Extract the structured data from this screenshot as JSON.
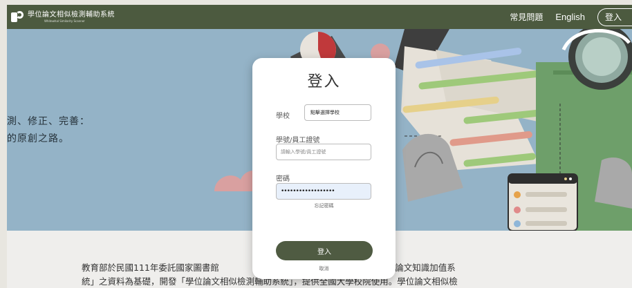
{
  "header": {
    "logo_title": "學位論文相似檢測輔助系統",
    "logo_subtitle": "Whitewhal Similarity Scanner",
    "nav": {
      "faq": "常見問題",
      "language": "English",
      "login": "登入"
    }
  },
  "hero": {
    "line1": "測、修正、完善：",
    "line2": "的原創之路。"
  },
  "intro": {
    "line1": "教育部於民國111年委託國家圖書館                                          以「臺灣博碩士論文知識加值系",
    "line2": "統」之資料為基礎，開發「學位論文相似檢測輔助系統」，提供全國大學校院使用。學位論文相似檢"
  },
  "login_modal": {
    "title": "登入",
    "school_label": "學校",
    "school_button": "點擊選擇學校",
    "id_label": "學號/員工證號",
    "id_placeholder": "請輸入學號/員工證號",
    "password_label": "密碼",
    "password_value": "••••••••••••••••••",
    "forgot_password": "忘記密碼",
    "submit": "登入",
    "cancel": "取消"
  },
  "colors": {
    "topbar": "#4c5a3f",
    "hero_bg": "#94b3c7",
    "accent_green": "#4f5b42",
    "page_bg": "#efeeec"
  }
}
